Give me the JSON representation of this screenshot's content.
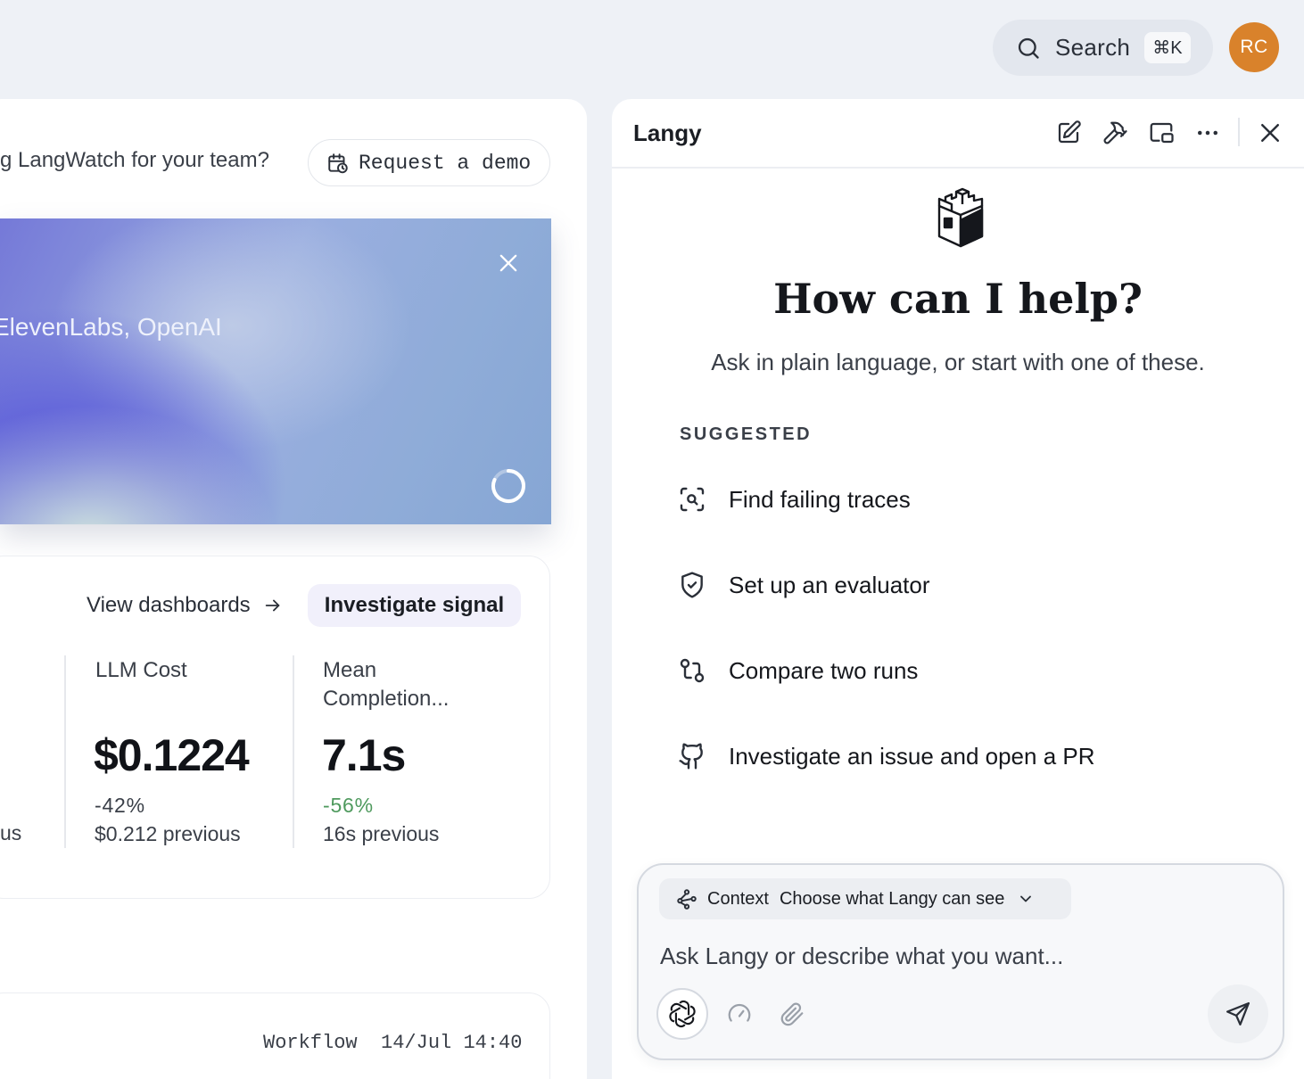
{
  "topbar": {
    "search_label": "Search",
    "search_shortcut": "⌘K",
    "avatar_initials": "RC",
    "avatar_color": "#d9822b"
  },
  "main": {
    "team_prompt": "g LangWatch for your team?",
    "demo_button": "Request a demo",
    "hero": {
      "text": "ElevenLabs, OpenAI"
    },
    "metrics": {
      "view_dashboards": "View dashboards",
      "investigate_button": "Investigate signal",
      "clipped_prev_suffix": "us",
      "items": [
        {
          "label": "LLM Cost",
          "value": "$0.1224",
          "delta": "-42%",
          "previous": "$0.212 previous"
        },
        {
          "label": "Mean\nCompletion...",
          "value": "7.1s",
          "delta": "-56%",
          "previous": "16s previous"
        }
      ]
    },
    "workflow_row": {
      "label": "Workflow",
      "timestamp": "14/Jul 14:40"
    }
  },
  "panel": {
    "title": "Langy",
    "heading": "How can I help?",
    "subheading": "Ask in plain language, or start with one of these.",
    "suggested_label": "SUGGESTED",
    "suggestions": [
      {
        "label": "Find failing traces",
        "icon": "scan-search-icon"
      },
      {
        "label": "Set up an evaluator",
        "icon": "shield-check-icon"
      },
      {
        "label": "Compare two runs",
        "icon": "git-compare-icon"
      },
      {
        "label": "Investigate an issue and open a PR",
        "icon": "github-icon"
      }
    ],
    "composer": {
      "context_label": "Context",
      "context_value": "Choose what Langy can see",
      "placeholder": "Ask Langy or describe what you want..."
    }
  }
}
